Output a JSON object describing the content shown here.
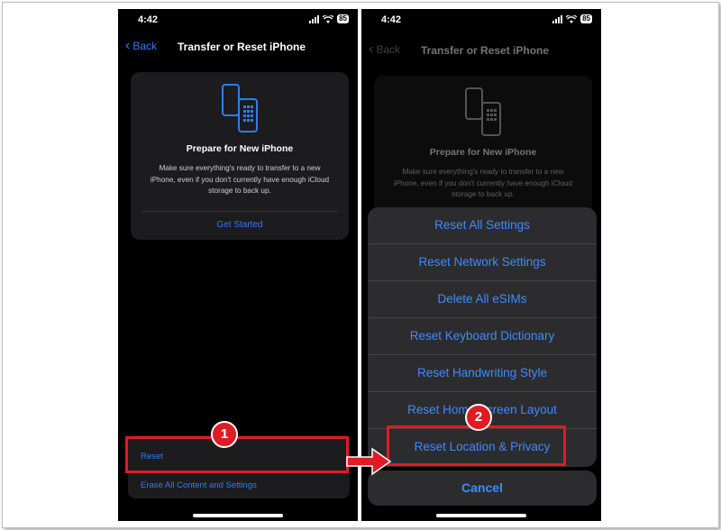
{
  "status": {
    "time": "4:42",
    "battery": "85"
  },
  "nav": {
    "back_label": "Back",
    "title": "Transfer or Reset iPhone"
  },
  "card": {
    "title": "Prepare for New iPhone",
    "body": "Make sure everything's ready to transfer to a new iPhone, even if you don't currently have enough iCloud storage to back up.",
    "link": "Get Started"
  },
  "list": {
    "reset": "Reset",
    "erase": "Erase All Content and Settings"
  },
  "sheet": {
    "items": [
      "Reset All Settings",
      "Reset Network Settings",
      "Delete All eSIMs",
      "Reset Keyboard Dictionary",
      "Reset Handwriting Style",
      "Reset Home Screen Layout",
      "Reset Location & Privacy"
    ],
    "cancel": "Cancel"
  },
  "annotations": {
    "step1": "1",
    "step2": "2",
    "highlight_color": "#e01b24"
  },
  "colors": {
    "accent": "#2f7cf6",
    "background": "#000000",
    "card": "#1c1c1e"
  }
}
